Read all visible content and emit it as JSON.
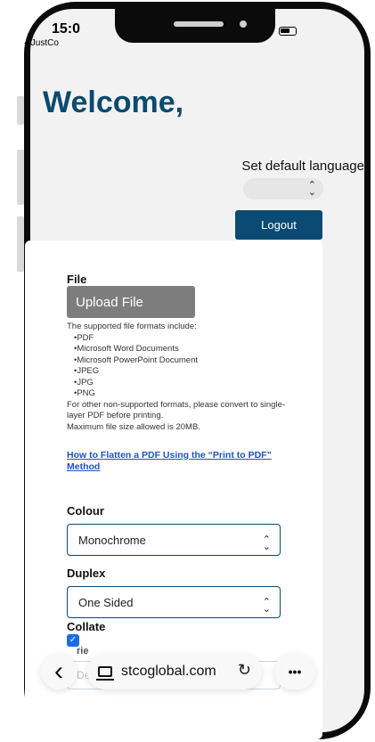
{
  "status": {
    "time": "15:0",
    "back_app": "◂ JustCo",
    "signal": "....",
    "wifi": "wifi-icon",
    "battery": "battery-icon"
  },
  "header": {
    "welcome": "Welcome,",
    "lang_label": "Set default language",
    "lang_value": "",
    "logout": "Logout"
  },
  "file": {
    "title": "File",
    "upload": "Upload File",
    "supported_intro": "The supported file formats include:",
    "formats": [
      "•PDF",
      "•Microsoft Word Documents",
      "•Microsoft PowerPoint Document",
      "•JPEG",
      "•JPG",
      "•PNG"
    ],
    "other_note": "For other non-supported formats, please convert to single-layer PDF before printing.",
    "max_size": "Maximum file size allowed is 20MB.",
    "help_link": "How to Flatten a PDF Using the “Print to PDF” Method"
  },
  "colour": {
    "title": "Colour",
    "value": "Monochrome"
  },
  "duplex": {
    "title": "Duplex",
    "value": "One Sided"
  },
  "collate": {
    "title": "Collate",
    "checked": true,
    "check_mark": "✓"
  },
  "orientation": {
    "label_partial": "rie",
    "value": "Default(Portrait)"
  },
  "browser": {
    "url": "stcoglobal.com",
    "back": "‹",
    "more": "•••",
    "reload": "↻"
  },
  "colors": {
    "brand": "#0b4a6e",
    "button": "#0b4a73",
    "link": "#1a56b8",
    "upload": "#7d7d7d"
  }
}
